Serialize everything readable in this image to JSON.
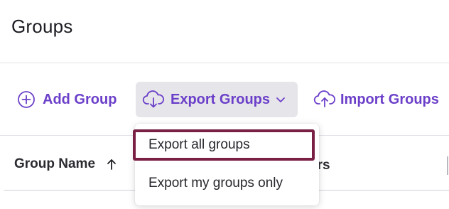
{
  "page": {
    "title": "Groups"
  },
  "toolbar": {
    "add_label": "Add Group",
    "export_label": "Export Groups",
    "import_label": "Import Groups"
  },
  "export_menu": {
    "items": [
      {
        "label": "Export all groups",
        "focused": true
      },
      {
        "label": "Export my groups only",
        "focused": false
      }
    ]
  },
  "table": {
    "columns": [
      {
        "label": "Group Name",
        "sort": "ascending"
      },
      {
        "label": "ers"
      }
    ]
  },
  "icons": {
    "add": "plus-circle-icon",
    "export": "cloud-download-icon",
    "export_menu": "chevron-down-icon",
    "import": "cloud-upload-icon",
    "sort": "arrow-up-icon"
  },
  "colors": {
    "accent": "#6b3fc9",
    "focus_ring": "#7a2045",
    "active_button_bg": "#e6e6ea"
  }
}
